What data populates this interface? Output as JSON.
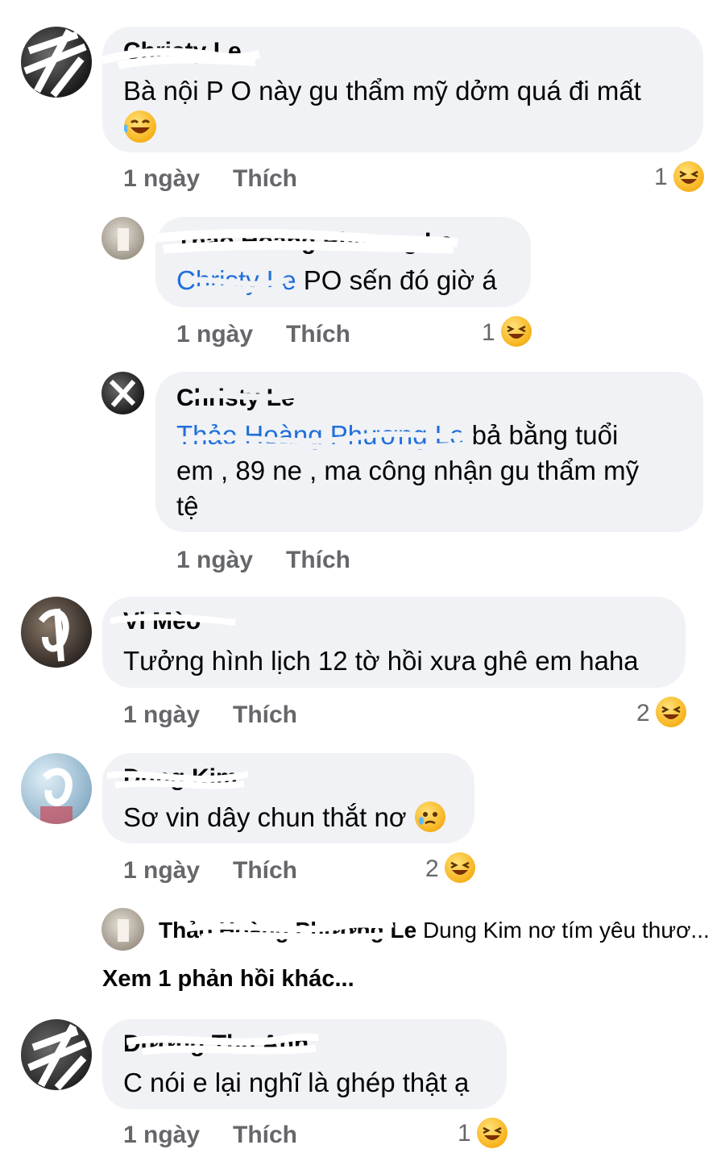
{
  "comments": [
    {
      "author": "Christy Le",
      "text": "Bà nội P O này gu thẩm mỹ dởm quá đi mất",
      "time": "1 ngày",
      "like_label": "Thích",
      "reaction_count": "1",
      "reaction_icon": "laughing-emoji-icon",
      "inline_emoji": "rolling-laughing-emoji-icon"
    },
    {
      "author": "Thảo Hoàng Phương Le",
      "mention": "Christy Le",
      "text": " PO sến đó giờ á",
      "time": "1 ngày",
      "like_label": "Thích",
      "reaction_count": "1",
      "reaction_icon": "laughing-emoji-icon"
    },
    {
      "author": "Christy Le",
      "mention": "Thảo Hoàng Phương Le",
      "text_line1": " bả bằng tuổi",
      "text_line2": "em , 89 ne , ma công nhận gu thẩm mỹ",
      "text_line3": "tệ",
      "time": "1 ngày",
      "like_label": "Thích"
    },
    {
      "author": "Vi Mèo",
      "text": "Tưởng hình lịch 12  tờ hồi xưa ghê em haha",
      "time": "1 ngày",
      "like_label": "Thích",
      "reaction_count": "2",
      "reaction_icon": "laughing-emoji-icon"
    },
    {
      "author": "Dung Kim",
      "text": "Sơ vin dây chun thắt nơ",
      "inline_emoji": "holding-back-tears-emoji-icon",
      "time": "1 ngày",
      "like_label": "Thích",
      "reaction_count": "2",
      "reaction_icon": "laughing-emoji-icon"
    },
    {
      "author": "Dương Thu Anh",
      "text": "C nói e lại nghĩ là ghép thật ạ",
      "time": "1 ngày",
      "like_label": "Thích",
      "reaction_count": "1",
      "reaction_icon": "laughing-emoji-icon"
    }
  ],
  "reply_preview": {
    "author": "Thảo Hoàng Phương Le",
    "text": " Dung Kim nơ tím yêu thươ..."
  },
  "more_replies_label": "Xem 1 phản hồi khác...",
  "colors": {
    "bubble": "#f0f2f5",
    "meta_text": "#65676b",
    "mention": "#216fdb",
    "emoji": "#f7b21b"
  }
}
